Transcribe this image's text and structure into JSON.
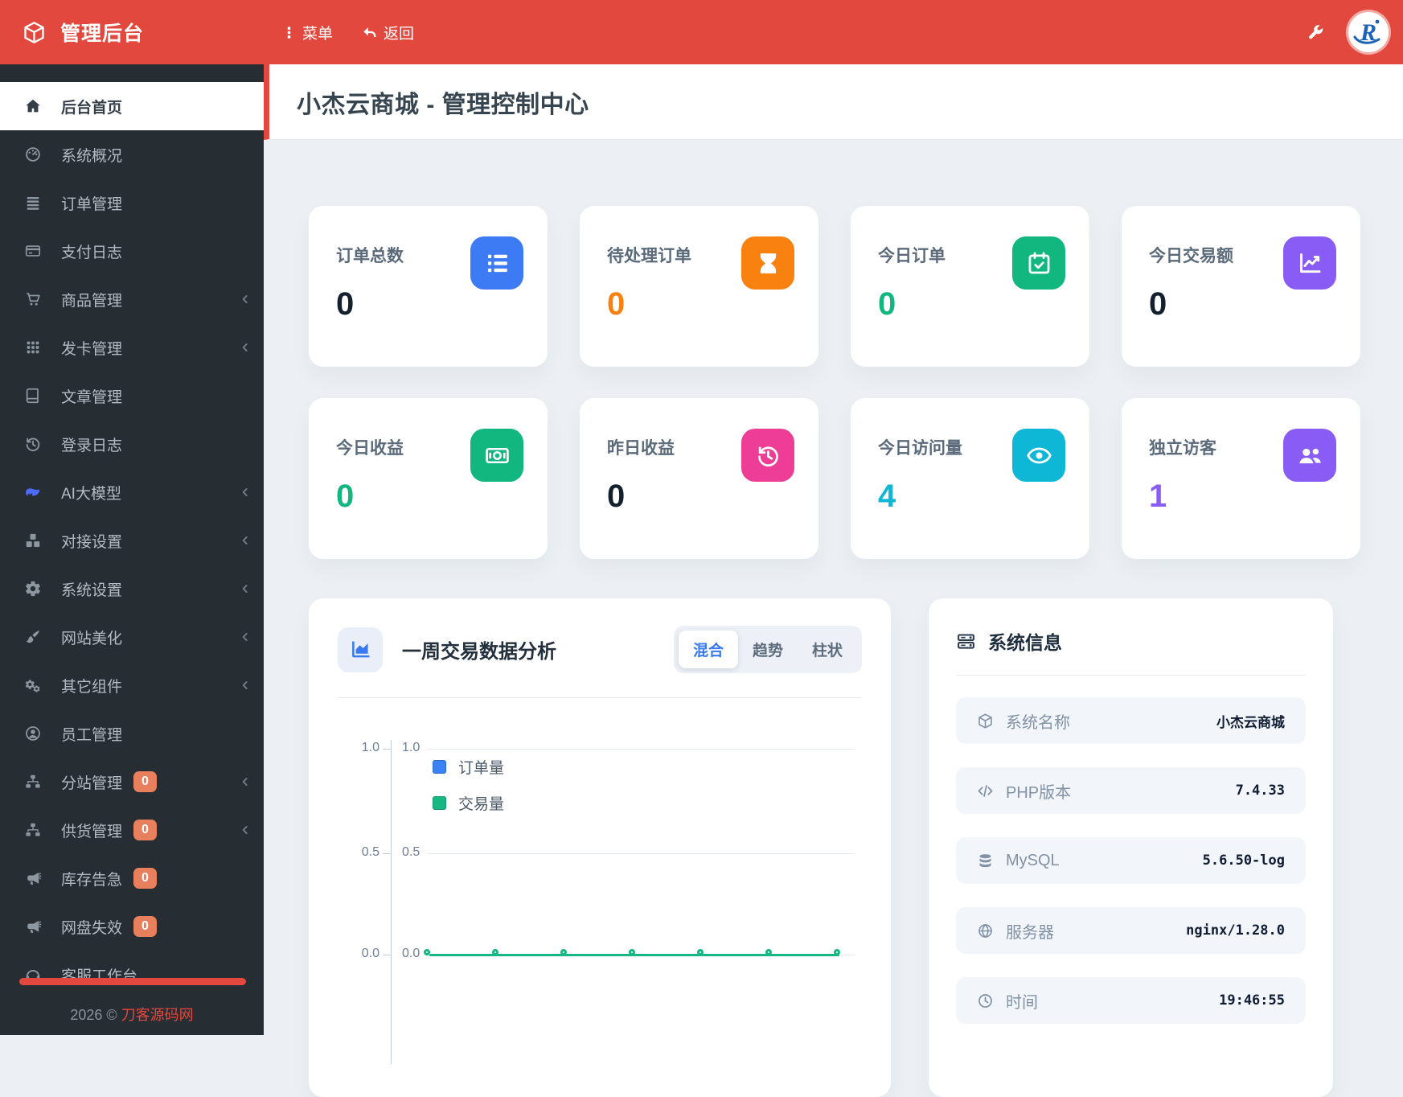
{
  "header": {
    "app_title": "管理后台",
    "menu_label": "菜单",
    "back_label": "返回",
    "accent_color": "#e2483d"
  },
  "sidebar": {
    "footer_year": "2026 © ",
    "footer_brand": "刀客源码网",
    "items": [
      {
        "label": "后台首页",
        "icon": "home-icon",
        "active": true
      },
      {
        "label": "系统概况",
        "icon": "gauge-icon"
      },
      {
        "label": "订单管理",
        "icon": "list-icon"
      },
      {
        "label": "支付日志",
        "icon": "credit-card-icon"
      },
      {
        "label": "商品管理",
        "icon": "cart-icon",
        "chevron": true
      },
      {
        "label": "发卡管理",
        "icon": "grid-icon",
        "chevron": true
      },
      {
        "label": "文章管理",
        "icon": "book-icon"
      },
      {
        "label": "登录日志",
        "icon": "history-icon"
      },
      {
        "label": "AI大模型",
        "icon": "whale-icon",
        "chevron": true,
        "icon_color": "#4d6bfe"
      },
      {
        "label": "对接设置",
        "icon": "cubes-icon",
        "chevron": true
      },
      {
        "label": "系统设置",
        "icon": "gear-icon",
        "chevron": true
      },
      {
        "label": "网站美化",
        "icon": "brush-icon",
        "chevron": true
      },
      {
        "label": "其它组件",
        "icon": "gears-icon",
        "chevron": true
      },
      {
        "label": "员工管理",
        "icon": "user-circle-icon"
      },
      {
        "label": "分站管理",
        "icon": "sitemap-icon",
        "chevron": true,
        "badge": "0"
      },
      {
        "label": "供货管理",
        "icon": "sitemap-icon",
        "chevron": true,
        "badge": "0"
      },
      {
        "label": "库存告急",
        "icon": "bullhorn-icon",
        "badge": "0"
      },
      {
        "label": "网盘失效",
        "icon": "bullhorn-icon",
        "badge": "0"
      },
      {
        "label": "客服工作台",
        "icon": "headset-icon"
      }
    ],
    "badge_color": "#e87f5d"
  },
  "page": {
    "title": "小杰云商城 - 管理控制中心"
  },
  "stat_cards": [
    {
      "label": "订单总数",
      "value": "0",
      "icon": "list-ol-icon",
      "icon_bg": "#3d7bf5",
      "value_color": "#15202e"
    },
    {
      "label": "待处理订单",
      "value": "0",
      "icon": "hourglass-icon",
      "icon_bg": "#f9810f",
      "value_color": "#f9810f"
    },
    {
      "label": "今日订单",
      "value": "0",
      "icon": "calendar-check-icon",
      "icon_bg": "#12b780",
      "value_color": "#12b780"
    },
    {
      "label": "今日交易额",
      "value": "0",
      "icon": "chart-line-icon",
      "icon_bg": "#8a5cf6",
      "value_color": "#15202e"
    },
    {
      "label": "今日收益",
      "value": "0",
      "icon": "money-icon",
      "icon_bg": "#12b780",
      "value_color": "#12b780"
    },
    {
      "label": "昨日收益",
      "value": "0",
      "icon": "history-icon",
      "icon_bg": "#ee3d96",
      "value_color": "#15202e"
    },
    {
      "label": "今日访问量",
      "value": "4",
      "icon": "eye-icon",
      "icon_bg": "#0db7d5",
      "value_color": "#0db7d5"
    },
    {
      "label": "独立访客",
      "value": "1",
      "icon": "users-icon",
      "icon_bg": "#8a5cf6",
      "value_color": "#8a5cf6"
    }
  ],
  "chart_card": {
    "title": "一周交易数据分析",
    "tabs": [
      {
        "label": "混合",
        "active": true
      },
      {
        "label": "趋势",
        "active": false
      },
      {
        "label": "柱状",
        "active": false
      }
    ]
  },
  "chart_data": {
    "type": "line",
    "title": "一周交易数据分析",
    "legend": [
      "订单量",
      "交易量"
    ],
    "legend_position": "top-left-vertical",
    "series": [
      {
        "name": "订单量",
        "color": "#3b82f6",
        "values": [
          0,
          0,
          0,
          0,
          0,
          0,
          0
        ]
      },
      {
        "name": "交易量",
        "color": "#17b784",
        "values": [
          0,
          0,
          0,
          0,
          0,
          0,
          0
        ]
      }
    ],
    "num_points": 7,
    "x_labels": [],
    "y_axis": {
      "ticks": [
        "1.0",
        "0.5",
        "0.0"
      ],
      "range": [
        0,
        1
      ]
    },
    "y_axis_secondary": {
      "ticks": [
        "1.0",
        "0.5",
        "0.0"
      ],
      "range": [
        0,
        1
      ]
    },
    "grid": true
  },
  "system_info": {
    "title": "系统信息",
    "rows": [
      {
        "icon": "cube-icon",
        "label": "系统名称",
        "value": "小杰云商城"
      },
      {
        "icon": "code-icon",
        "label": "PHP版本",
        "value": "7.4.33"
      },
      {
        "icon": "database-icon",
        "label": "MySQL",
        "value": "5.6.50-log"
      },
      {
        "icon": "globe-icon",
        "label": "服务器",
        "value": "nginx/1.28.0"
      },
      {
        "icon": "clock-icon",
        "label": "时间",
        "value": "19:46:55"
      }
    ]
  }
}
